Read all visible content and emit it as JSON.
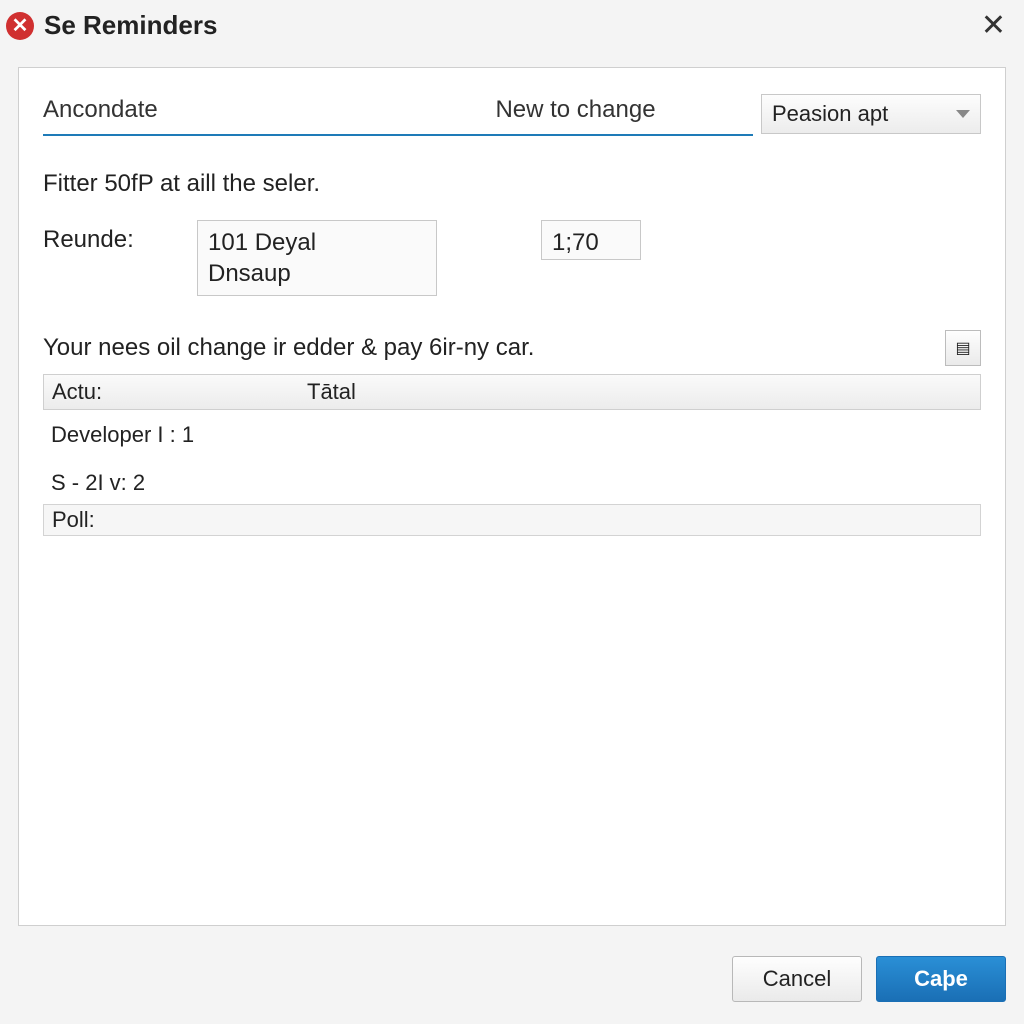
{
  "title": "Se Reminders",
  "tabs": {
    "t1": "Ancondate",
    "t2": "New to change"
  },
  "dropdown": {
    "selected": "Peasion apt"
  },
  "subtitle": "Fitter 50fP at aill the seler.",
  "reunde": {
    "label": "Reunde:",
    "value1": "101 Deyal\nDnsaup",
    "value2": "1;70"
  },
  "note": "Your nees oil change ir edder & pay 6ir-ny car.",
  "headers": {
    "c1": "Actu:",
    "c2": "Tātal"
  },
  "rows": {
    "r1": "Developer I : 1",
    "r2": "S - 2I v: 2"
  },
  "footer_label": "Poll:",
  "buttons": {
    "cancel": "Cancel",
    "ok": "Caþe"
  }
}
